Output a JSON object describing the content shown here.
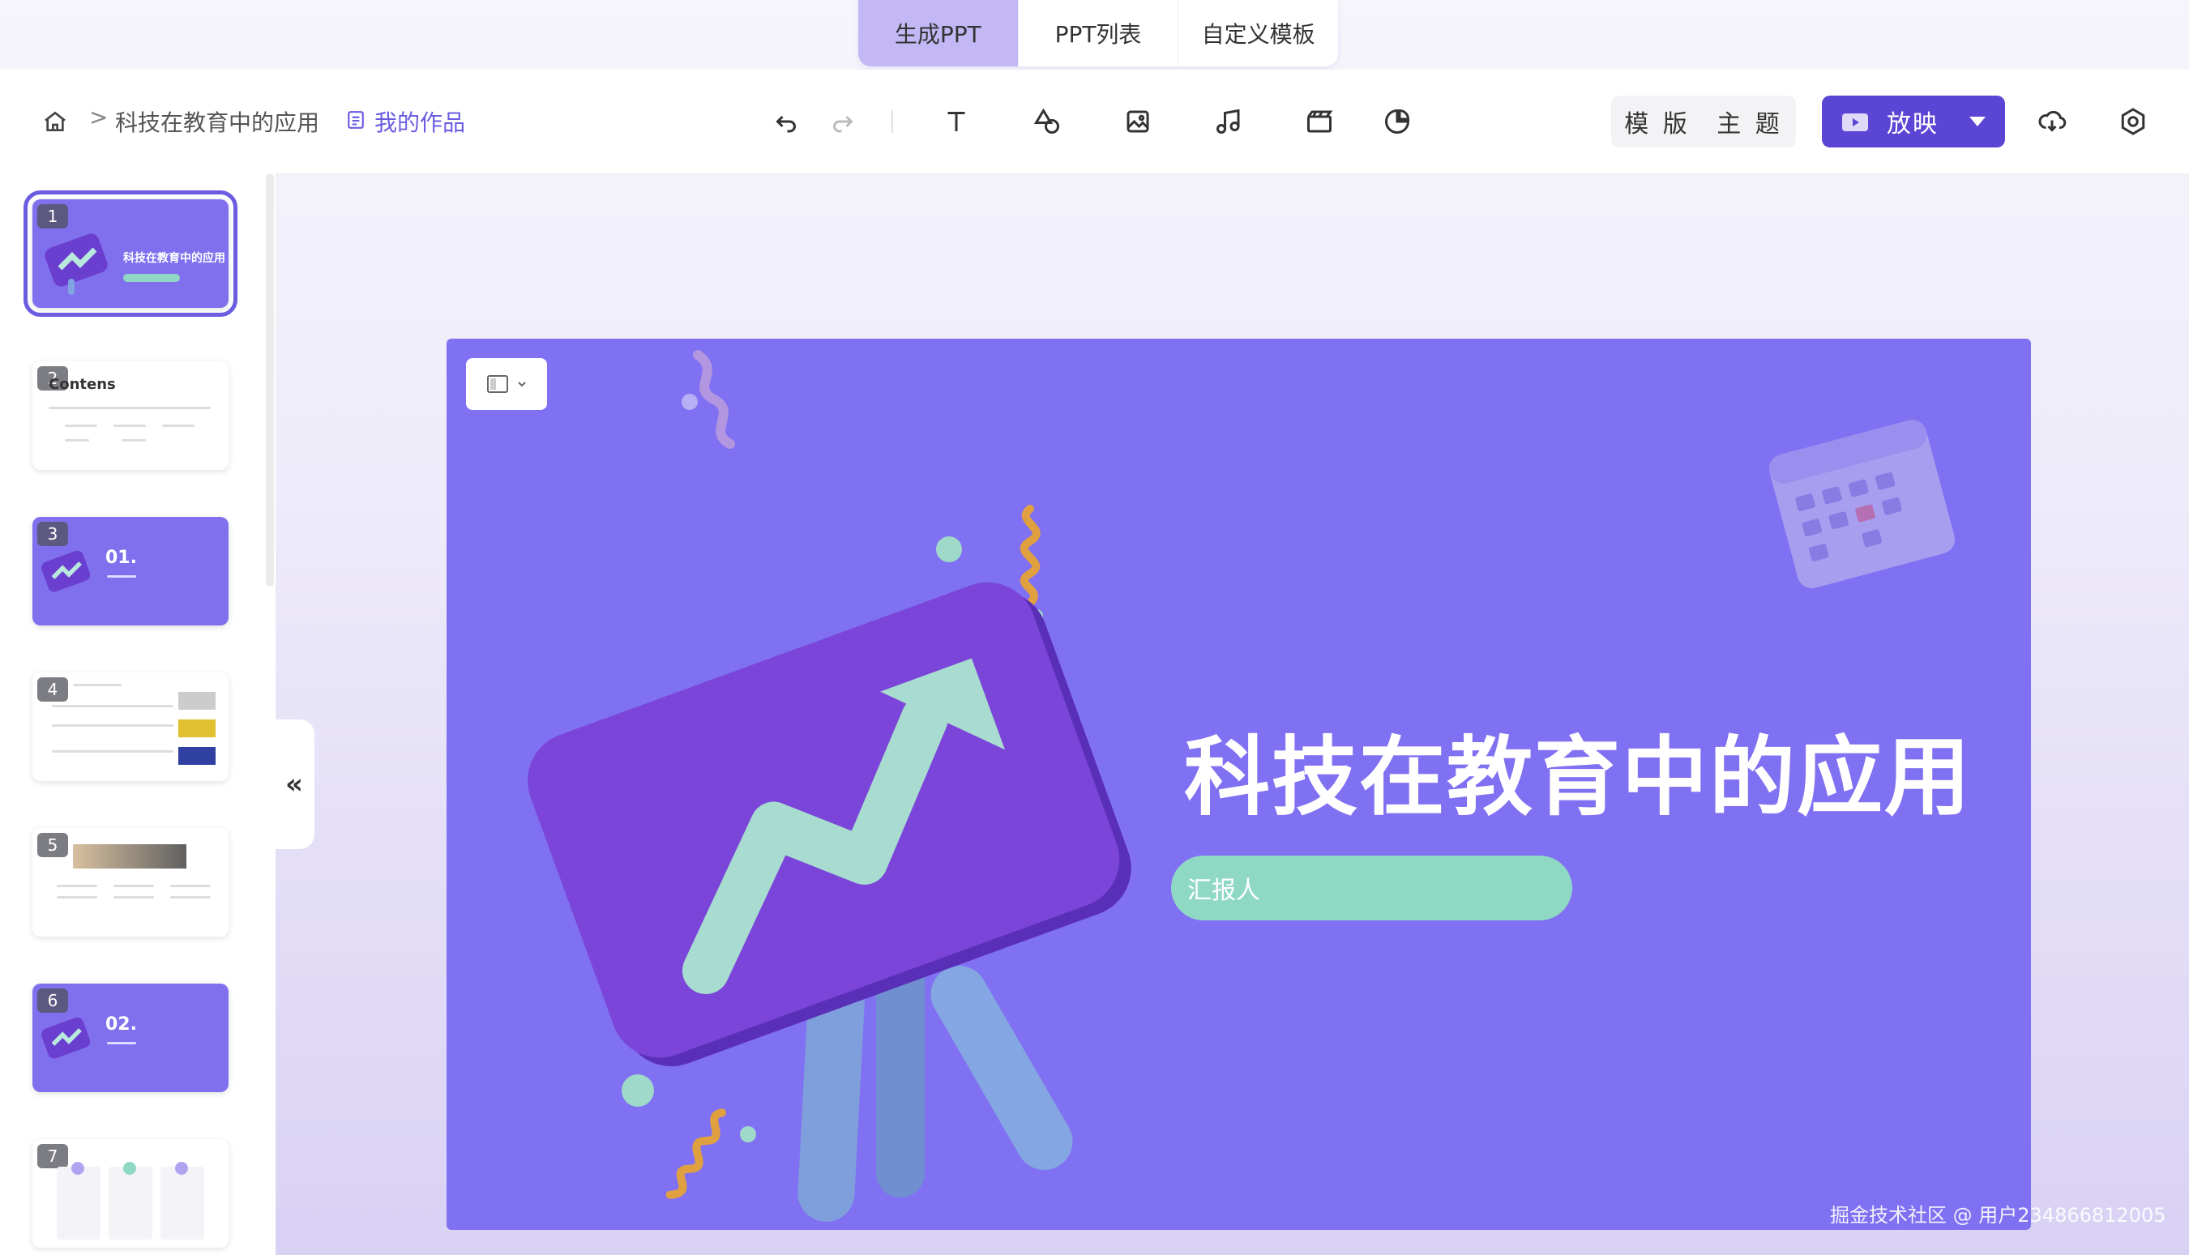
{
  "mode_tabs": [
    {
      "label": "生成PPT",
      "active": true
    },
    {
      "label": "PPT列表",
      "active": false
    },
    {
      "label": "自定义模板",
      "active": false
    }
  ],
  "breadcrumb": {
    "separator": ">",
    "title": "科技在教育中的应用",
    "link_label": "我的作品"
  },
  "toolbar": {
    "template_label": "模 版",
    "theme_label": "主 题",
    "play_label": "放映"
  },
  "thumbnails": [
    {
      "number": "1",
      "title": "科技在教育中的应用"
    },
    {
      "number": "2",
      "title": "Contens"
    },
    {
      "number": "3",
      "title": "01."
    },
    {
      "number": "4",
      "title": ""
    },
    {
      "number": "5",
      "title": ""
    },
    {
      "number": "6",
      "title": "02."
    },
    {
      "number": "7",
      "title": ""
    }
  ],
  "slide": {
    "title": "科技在教育中的应用",
    "reporter": "汇报人"
  },
  "watermark": "掘金技术社区 @ 用户234866812005",
  "colors": {
    "accent": "#6b5ce0",
    "slide_bg": "#8070f2",
    "mint": "#8fd9c4",
    "play_btn": "#5a45d4"
  }
}
